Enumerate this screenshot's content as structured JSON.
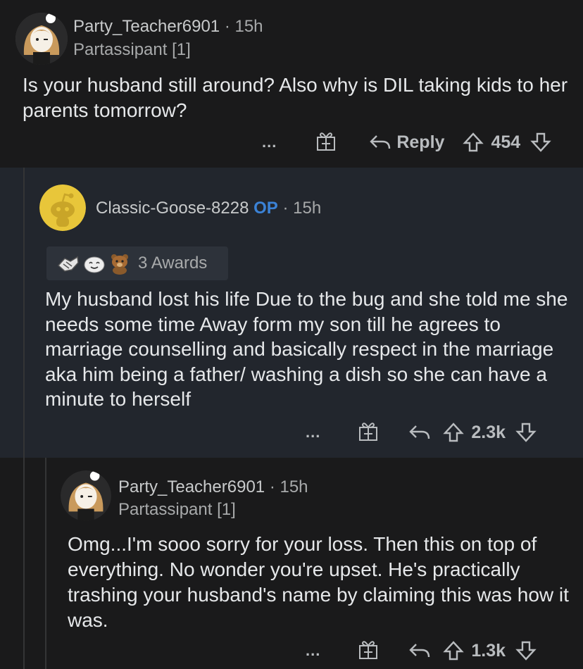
{
  "comments": [
    {
      "username": "Party_Teacher6901",
      "separator": "·",
      "time": "15h",
      "flair": "Partassipant [1]",
      "body": "Is your husband still around? Also why is DIL taking kids to her parents tomorrow?",
      "more": "...",
      "reply_label": "Reply",
      "votes": "454"
    },
    {
      "username": "Classic-Goose-8228",
      "op_badge": "OP",
      "separator": "·",
      "time": "15h",
      "awards_label": "3 Awards",
      "body": "My husband lost his life Due to the bug and she told me she needs some time Away form my son till he agrees to marriage  counselling and basically respect in the marriage aka him being a father/ washing a dish so she can have a minute to herself",
      "more": "...",
      "votes": "2.3k"
    },
    {
      "username": "Party_Teacher6901",
      "separator": "·",
      "time": "15h",
      "flair": "Partassipant [1]",
      "body": "Omg...I'm sooo sorry for your loss. Then this on top of everything. No wonder you're upset. He's practically trashing your husband's name by claiming this was how it was.",
      "more": "...",
      "votes": "1.3k"
    }
  ],
  "icons": [
    "avatar-girl",
    "avatar-snoo-yellow",
    "gift-icon",
    "reply-arrow-icon",
    "upvote-icon",
    "downvote-icon",
    "award-handshake-icon",
    "award-wholesome-icon",
    "award-bear-icon"
  ],
  "colors": {
    "op": "#3b82d6",
    "background": "#1a1a1b",
    "highlight": "#22262d"
  }
}
